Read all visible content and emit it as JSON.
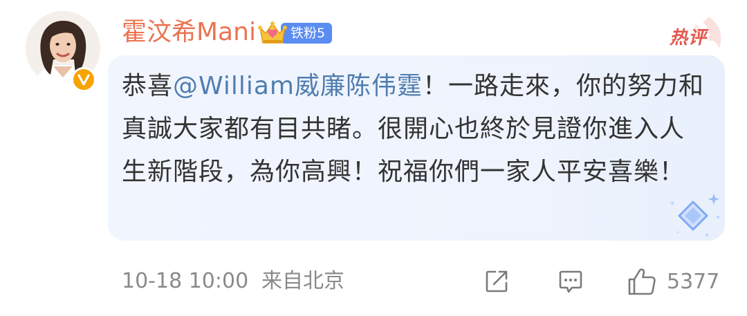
{
  "comment": {
    "username": "霍汶希Mani",
    "fan_badge_label": "铁粉5",
    "hot_label": "热评",
    "text_prefix": "恭喜",
    "mention": "@William威廉陈伟霆",
    "text_body": "！一路走來，你的努力和真誠大家都有目共睹。很開心也終於見證你進入人生新階段，為你高興！祝福你們一家人平安喜樂！",
    "timestamp": "10-18 10:00",
    "location": "来自北京",
    "like_count": "5377"
  },
  "icons": {
    "share": "share-icon",
    "comment": "comment-icon",
    "like": "like-icon",
    "verified": "verified-v-icon",
    "crown": "crown-icon"
  },
  "colors": {
    "username": "#eb7350",
    "mention": "#507daf",
    "body_text": "#333333",
    "meta_text": "#8a8a8a",
    "fan_badge": "#5a8cf2",
    "hot_badge": "#e5584f",
    "verified_badge": "#f7a300",
    "bubble_bg": "#eef3fd"
  }
}
